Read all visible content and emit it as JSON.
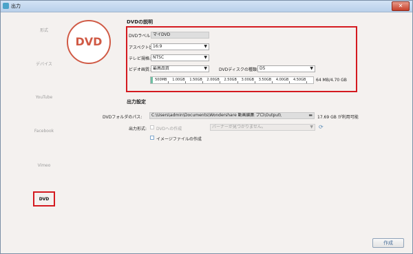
{
  "window": {
    "title": "出力",
    "close": "✕"
  },
  "sidebar": [
    {
      "label": "形式"
    },
    {
      "label": "デバイス"
    },
    {
      "label": "YouTube"
    },
    {
      "label": "Facebook"
    },
    {
      "label": "Vimeo"
    },
    {
      "label": "DVD"
    }
  ],
  "hero": {
    "label": "DVD"
  },
  "dvd": {
    "section_title": "DVDの説明",
    "label_label": "DVDラベル:",
    "label_value": "マイDVD",
    "aspect_label": "アスペクト比:",
    "aspect_value": "16:9",
    "tv_label": "テレビ規格:",
    "tv_value": "NTSC",
    "quality_label": "ビデオ画質:",
    "quality_value": "最高品質",
    "disc_label": "DVDディスクの種類:",
    "disc_value": "D5",
    "capacity_ticks": [
      "500MB",
      "1.00GB",
      "1.50GB",
      "2.00GB",
      "2.50GB",
      "3.00GB",
      "3.50GB",
      "4.00GB",
      "4.50GB"
    ],
    "capacity_text": "64 MB/4.70 GB",
    "capacity_used_mb": 64,
    "capacity_total_gb": 4.7
  },
  "output": {
    "section_title": "出力設定",
    "folder_label": "DVDフォルダのパス:",
    "folder_value": "C:\\Users\\admin\\Documents\\Wondershare 動画編集 プロ\\Output\\",
    "free_space": "17.69 GB が利用可能",
    "format_label": "出力形式:",
    "dvd_opt": "DVDへの作成",
    "burner_placeholder": "バーナーが見つかりません。",
    "iso_opt": "イメージファイルの作成"
  },
  "footer": {
    "create": "作成"
  },
  "colors": {
    "accent_red": "#d4191f",
    "hero_ring": "#d05a45",
    "capacity_fill": "#6fbfa2"
  }
}
